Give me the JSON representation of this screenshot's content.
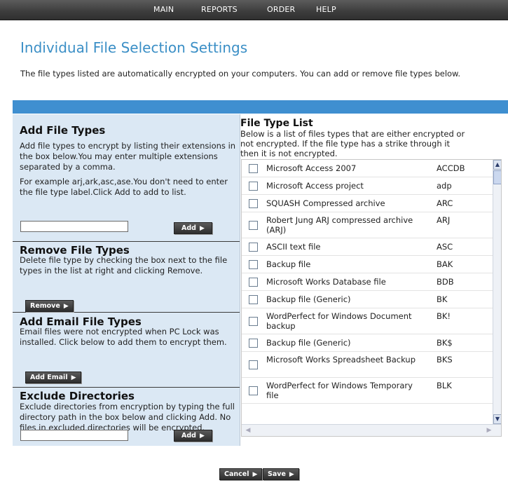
{
  "nav": [
    "MAIN",
    "REPORTS",
    "ORDER",
    "HELP"
  ],
  "page_title": "Individual File Selection Settings",
  "intro_text": "The file types listed are automatically encrypted on your computers. You can add or remove file types below.",
  "add_file_types": {
    "title": "Add File Types",
    "description": "Add file types to encrypt by listing their extensions in the box below.You may enter multiple extensions separated by a comma.",
    "example": "For example arj,ark,asc,ase.You don't need to enter the file type label.Click Add to add to list.",
    "input_value": "",
    "button": "Add"
  },
  "remove_file_types": {
    "title": "Remove File Types",
    "description": "Delete file type by checking the box next to the file types in the list at right and clicking Remove.",
    "button": "Remove"
  },
  "add_email_file_types": {
    "title": "Add Email File Types",
    "description": "Email files were not encrypted when PC Lock was installed. Click below to add them to encrypt them.",
    "button": "Add Email"
  },
  "exclude_directories": {
    "title": "Exclude Directories",
    "description": "Exclude directories from encryption by typing the full directory path in the box below and clicking Add. No files in excluded directories will be encrypted.",
    "input_value": "",
    "button": "Add"
  },
  "file_type_list": {
    "title": "File Type List",
    "description_lines": [
      "Below is a list of files types that are either encrypted or",
      "not encrypted. If the file type has a strike through it",
      "then it is not encrypted."
    ],
    "items": [
      {
        "name": "Microsoft Access 2007",
        "ext": "ACCDB",
        "checked": false
      },
      {
        "name": "Microsoft Access project",
        "ext": "adp",
        "checked": false
      },
      {
        "name": "SQUASH Compressed archive",
        "ext": "ARC",
        "checked": false
      },
      {
        "name": "Robert Jung ARJ compressed archive (ARJ)",
        "ext": "ARJ",
        "checked": false
      },
      {
        "name": "ASCII text file",
        "ext": "ASC",
        "checked": false
      },
      {
        "name": "Backup file",
        "ext": "BAK",
        "checked": false
      },
      {
        "name": "Microsoft Works Database file",
        "ext": "BDB",
        "checked": false
      },
      {
        "name": "Backup file (Generic)",
        "ext": "BK",
        "checked": false
      },
      {
        "name": "WordPerfect for Windows Document backup",
        "ext": "BK!",
        "checked": false
      },
      {
        "name": "Backup file (Generic)",
        "ext": "BK$",
        "checked": false
      },
      {
        "name": "Microsoft Works Spreadsheet Backup",
        "ext": "BKS",
        "checked": false
      },
      {
        "name": "WordPerfect for Windows Temporary file",
        "ext": "BLK",
        "checked": false
      }
    ]
  },
  "footer": {
    "cancel": "Cancel",
    "save": "Save"
  },
  "colors": {
    "title": "#3b8fc6",
    "band": "#3f8fd0",
    "panel": "#dbe8f4",
    "nav": "#3e3e3e"
  }
}
